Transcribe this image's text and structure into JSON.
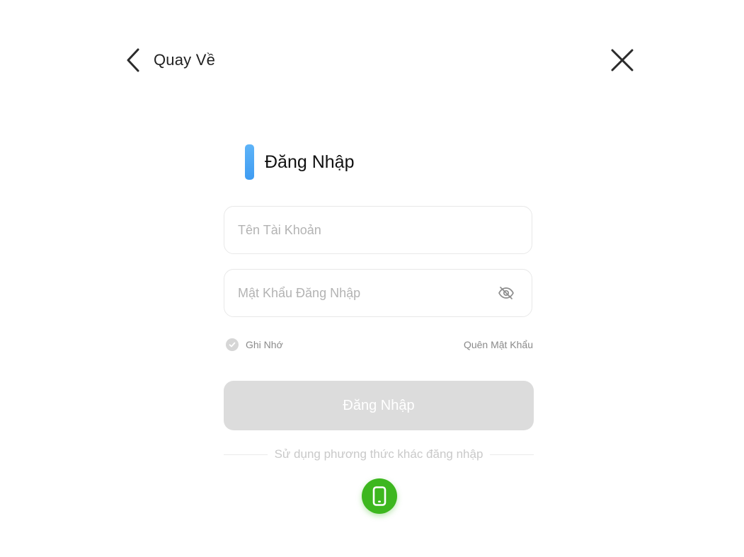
{
  "header": {
    "back_label": "Quay Về",
    "back_icon": "chevron-left-icon",
    "close_icon": "close-icon"
  },
  "title": {
    "text": "Đăng Nhập",
    "accent_color": "#4BA8F5"
  },
  "form": {
    "username": {
      "value": "",
      "placeholder": "Tên Tài Khoản"
    },
    "password": {
      "value": "",
      "placeholder": "Mật Khẩu Đăng Nhập",
      "toggle_icon": "eye-off-icon"
    },
    "remember": {
      "label": "Ghi Nhớ",
      "checked": false
    },
    "forgot_label": "Quên Mật Khẩu",
    "submit_label": "Đăng Nhập",
    "submit_color": "#DCDCDC"
  },
  "alternative": {
    "divider_text": "Sử dụng phương thức khác đăng nhập",
    "methods": [
      {
        "icon": "phone-icon",
        "color": "#3DB71F"
      }
    ]
  }
}
